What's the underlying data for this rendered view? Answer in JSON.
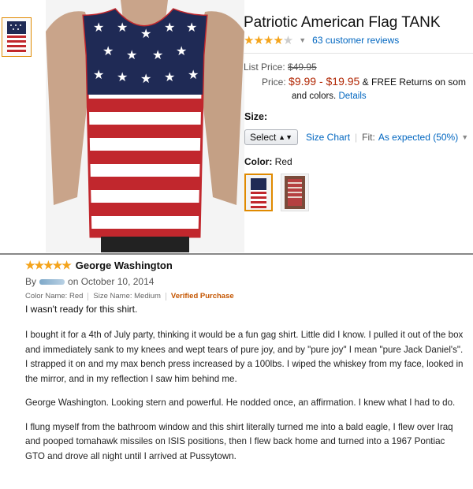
{
  "product": {
    "title": "Patriotic American Flag TANK",
    "rating": 3.5,
    "stars_text": "★★★★",
    "stars_off_text": "★",
    "reviews_link": "63 customer reviews",
    "list_price_label": "List Price:",
    "list_price_value": "$49.95",
    "price_label": "Price:",
    "price_value": "$9.99 - $19.95",
    "price_suffix": "& FREE Returns on som",
    "price_line2_prefix": "and colors.",
    "details_link": "Details",
    "size_label": "Size:",
    "select_label": "Select",
    "size_chart_link": "Size Chart",
    "fit_label": "Fit:",
    "fit_value": "As expected (50%)",
    "color_label": "Color:",
    "color_value": "Red"
  },
  "review": {
    "stars": "★★★★★",
    "reviewer": "George Washington",
    "by_label": "By",
    "date": "on October 10, 2014",
    "color_name": "Color Name: Red",
    "size_name": "Size Name: Medium",
    "verified": "Verified Purchase",
    "headline": "I wasn't ready for this shirt.",
    "p1": "I bought it for a 4th of July party, thinking it would be a fun gag shirt. Little did I know. I pulled it out of the box and immediately sank to my knees and wept tears of pure joy, and by \"pure joy\" I mean \"pure Jack Daniel's\". I strapped it on and my max bench press increased by a 100lbs. I wiped the whiskey from my face, looked in the mirror, and in my reflection I saw him behind me.",
    "p2": "George Washington. Looking stern and powerful. He nodded once, an affirmation. I knew what I had to do.",
    "p3": "I flung myself from the bathroom window and this shirt literally turned me into a bald eagle, I flew over Iraq and pooped tomahawk missiles on ISIS positions, then I flew back home and turned into a 1967 Pontiac GTO and drove all night until I arrived at Pussytown."
  },
  "colors": {
    "link": "#0066c0",
    "price": "#b12704",
    "star": "#f4a41c",
    "verified": "#c45500",
    "flag_red": "#c1272d",
    "flag_blue": "#1f2a55"
  }
}
